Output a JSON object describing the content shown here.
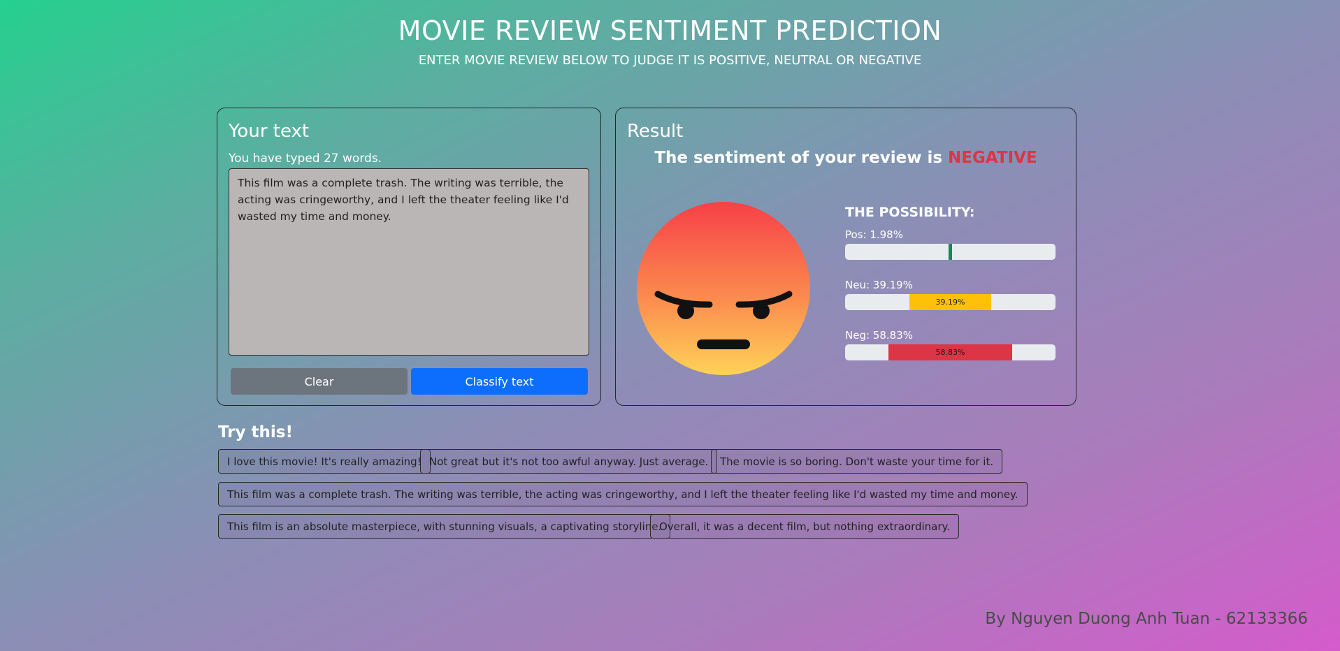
{
  "header": {
    "title": "MOVIE REVIEW SENTIMENT PREDICTION",
    "subtitle": "ENTER MOVIE REVIEW BELOW TO JUDGE IT IS POSITIVE, NEUTRAL OR NEGATIVE"
  },
  "input_card": {
    "title": "Your text",
    "word_count": "You have typed 27 words.",
    "text": "This film was a complete trash. The writing was terrible, the acting was cringeworthy, and I left the theater feeling like I'd wasted my time and money.",
    "clear_label": "Clear",
    "classify_label": "Classify text"
  },
  "result_card": {
    "title": "Result",
    "sentiment_prefix": "The sentiment of your review is ",
    "sentiment_value": "NEGATIVE",
    "emoji_icon": "angry-face-icon",
    "possibility_title": "THE POSSIBILITY:",
    "probabilities": [
      {
        "label": "Pos: 1.98%",
        "value": 1.98,
        "bar_text": "",
        "color": "#198754"
      },
      {
        "label": "Neu: 39.19%",
        "value": 39.19,
        "bar_text": "39.19%",
        "color": "#ffc107"
      },
      {
        "label": "Neg: 58.83%",
        "value": 58.83,
        "bar_text": "58.83%",
        "color": "#dc3545"
      }
    ]
  },
  "examples": {
    "title": "Try this!",
    "items": [
      "I love this movie! It's really amazing!",
      "Not great but it's not too awful anyway. Just average.",
      "The movie is so boring. Don't waste your time for it.",
      "This film was a complete trash. The writing was terrible, the acting was cringeworthy, and I left the theater feeling like I'd wasted my time and money.",
      "This film is an absolute masterpiece, with stunning visuals, a captivating storyline.",
      "Overall, it was a decent film, but nothing extraordinary."
    ]
  },
  "footer": {
    "credit": "By Nguyen Duong Anh Tuan - 62133366"
  }
}
